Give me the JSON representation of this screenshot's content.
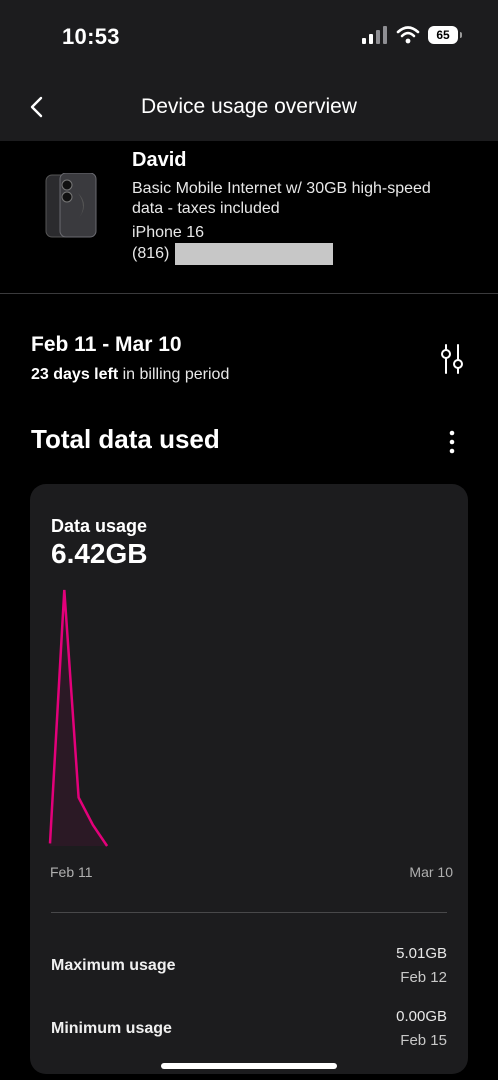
{
  "status_bar": {
    "time": "10:53",
    "battery": "65"
  },
  "header": {
    "title": "Device usage overview"
  },
  "device": {
    "name": "David",
    "plan": "Basic Mobile Internet w/ 30GB high-speed data - taxes included",
    "model": "iPhone 16",
    "area_code": "(816)"
  },
  "billing": {
    "period": "Feb 11 - Mar 10",
    "days_left": "23 days left",
    "days_left_suffix": "in billing period"
  },
  "section": {
    "title": "Total data used"
  },
  "card": {
    "label": "Data usage",
    "total": "6.42GB",
    "axis_start": "Feb 11",
    "axis_end": "Mar 10",
    "max_label": "Maximum usage",
    "max_value": "5.01GB",
    "max_date": "Feb 12",
    "min_label": "Minimum usage",
    "min_value": "0.00GB",
    "min_date": "Feb 15"
  },
  "chart_data": {
    "type": "line",
    "title": "",
    "xlabel": "",
    "ylabel": "",
    "x": [
      "Feb 11",
      "Feb 12",
      "Feb 13",
      "Feb 14",
      "Feb 15"
    ],
    "values": [
      0.05,
      5.01,
      0.95,
      0.41,
      0.0
    ],
    "xlim": [
      "Feb 11",
      "Mar 10"
    ],
    "ylim": [
      0,
      5.01
    ],
    "grid": false,
    "color": "#e3007a"
  },
  "colors": {
    "accent": "#e3007a",
    "card_bg": "#1c1c1e",
    "background": "#000000"
  }
}
